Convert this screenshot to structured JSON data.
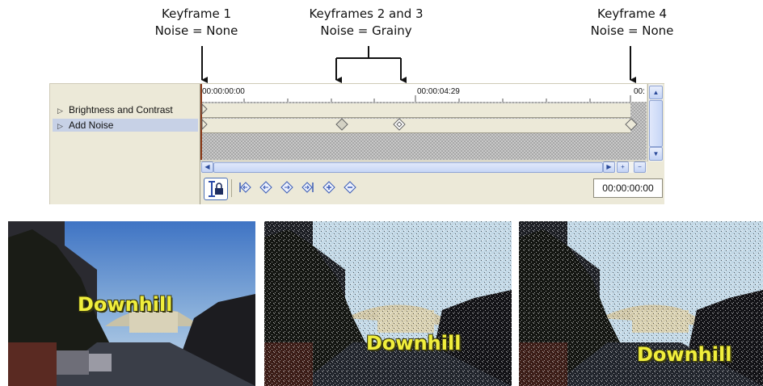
{
  "callouts": [
    {
      "title": "Keyframe 1",
      "value": "Noise = None"
    },
    {
      "title": "Keyframes 2 and 3",
      "value": "Noise = Grainy"
    },
    {
      "title": "Keyframe 4",
      "value": "Noise = None"
    }
  ],
  "timeline": {
    "tracks": [
      {
        "label": "Brightness and Contrast"
      },
      {
        "label": "Add Noise",
        "selected": true
      }
    ],
    "ruler": {
      "start": "00:00:00:00",
      "mid": "00:00:04:29",
      "end": "00:"
    },
    "current_time": "00:00:00:00",
    "toolbar_icons": [
      "lock-sync-icon",
      "first-keyframe-icon",
      "prev-keyframe-icon",
      "next-keyframe-icon",
      "last-keyframe-icon",
      "add-keyframe-icon",
      "delete-keyframe-icon"
    ]
  },
  "frames": [
    {
      "caption": "Downhill",
      "noise": "none"
    },
    {
      "caption": "Downhill",
      "noise": "grainy"
    },
    {
      "caption": "Downhill",
      "noise": "grainy"
    }
  ],
  "colors": {
    "accent": "#4a6fb5",
    "caption": "#f0ee3c",
    "track_selected": "#c7d1e6"
  }
}
